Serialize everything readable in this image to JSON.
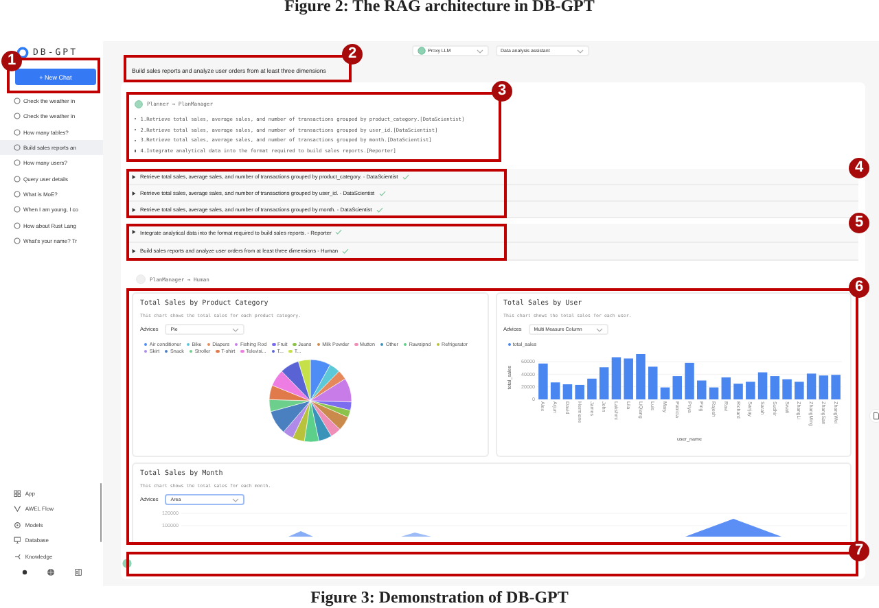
{
  "captions": {
    "top": "Figure 2: The RAG architecture in DB-GPT",
    "bottom": "Figure 3: Demonstration of DB-GPT"
  },
  "sidebar": {
    "logo": "DB-GPT",
    "new_chat": "+ New Chat",
    "chats": [
      {
        "title": "Check the weather in",
        "selected": false
      },
      {
        "title": "Check the weather in",
        "selected": false
      },
      {
        "title": "How many tables?",
        "selected": false
      },
      {
        "title": "Build sales reports an",
        "selected": true
      },
      {
        "title": "How many users?",
        "selected": false
      },
      {
        "title": "Query user details",
        "selected": false
      },
      {
        "title": "What is MoE?",
        "selected": false
      },
      {
        "title": "When I am young, I co",
        "selected": false
      },
      {
        "title": "How about Rust Lang",
        "selected": false
      },
      {
        "title": "What's your name? Tr",
        "selected": false
      }
    ],
    "menu": [
      {
        "label": "App"
      },
      {
        "label": "AWEL Flow"
      },
      {
        "label": "Models"
      },
      {
        "label": "Database"
      },
      {
        "label": "Knowledge"
      }
    ]
  },
  "toolbar": {
    "model": "Proxy LLM",
    "app": "Data analysis assistant"
  },
  "annotations": [
    "1",
    "2",
    "3",
    "4",
    "5",
    "6",
    "7"
  ],
  "message": "Build sales reports and analyze user orders from at least three dimensions",
  "planner": {
    "header": "Planner → PlanManager",
    "steps": [
      "1.Retrieve total sales, average sales, and number of transactions grouped by product_category.[DataScientist]",
      "2.Retrieve total sales, average sales, and number of transactions grouped by user_id.[DataScientist]",
      "3.Retrieve total sales, average sales, and number of transactions grouped by month.[DataScientist]",
      "4.Integrate analytical data into the format required to build sales reports.[Reporter]"
    ]
  },
  "task_groups": [
    [
      {
        "text": "Retrieve total sales, average sales, and number of transactions grouped by product_category. - DataScientist",
        "done": true
      },
      {
        "text": "Retrieve total sales, average sales, and number of transactions grouped by user_id. - DataScientist",
        "done": true
      },
      {
        "text": "Retrieve total sales, average sales, and number of transactions grouped by month. - DataScientist",
        "done": true
      }
    ],
    [
      {
        "text": "Integrate analytical data into the format required to build sales reports. - Reporter",
        "done": true
      },
      {
        "text": "Build sales reports and analyze user orders from at least three dimensions - Human",
        "done": true
      }
    ]
  ],
  "reply_header": "PlanManager → Human",
  "charts": {
    "category": {
      "title": "Total Sales by Product Category",
      "description": "This chart shows the total sales for each product category.",
      "advices_label": "Advices",
      "advice": "Pie",
      "legend": [
        {
          "label": "Air conditioner",
          "color": "#4e8df5"
        },
        {
          "label": "Bike",
          "color": "#5cc8d8"
        },
        {
          "label": "Diapers",
          "color": "#e5895c"
        },
        {
          "label": "Fishing Rod",
          "color": "#c77ce8"
        },
        {
          "label": "Fruit",
          "color": "#7b6cf0"
        },
        {
          "label": "Jeans",
          "color": "#8bc34a"
        },
        {
          "label": "Milk Powder",
          "color": "#c98a4b"
        },
        {
          "label": "Mutton",
          "color": "#ef8fb8"
        },
        {
          "label": "Other",
          "color": "#3a93b8"
        },
        {
          "label": "Rawsipnd",
          "color": "#5ccf8a"
        },
        {
          "label": "Refrigerator",
          "color": "#b8c23a"
        },
        {
          "label": "Skirt",
          "color": "#b08ae8"
        },
        {
          "label": "Snack",
          "color": "#4a7fc0"
        },
        {
          "label": "Stroller",
          "color": "#6cd08c"
        },
        {
          "label": "T-shirt",
          "color": "#e07a4a"
        },
        {
          "label": "Televisi...",
          "color": "#ee7de3"
        },
        {
          "label": "T...",
          "color": "#5a63d4"
        },
        {
          "label": "T...",
          "color": "#c6e04a"
        }
      ]
    },
    "user": {
      "title": "Total Sales by User",
      "description": "This chart shows the total sales for each user.",
      "advices_label": "Advices",
      "advice": "Multi Measure Column",
      "chart_data": {
        "type": "bar",
        "xlabel": "user_name",
        "ylabel": "total_sales",
        "categories": [
          "Alex",
          "Arjun",
          "David",
          "Hermione",
          "James",
          "John",
          "Lakshmi",
          "Lila",
          "LiQiang",
          "Luis",
          "Mary",
          "Patricia",
          "Priya",
          "Ping",
          "Rajesh",
          "Ravi",
          "Richard",
          "Sanjay",
          "Sarah",
          "Sudhir",
          "Swati",
          "ZhangLi",
          "ZhangMing",
          "ZhangSan",
          "ZhangWei"
        ],
        "series": [
          {
            "name": "total_sales",
            "color": "#4a86f0",
            "values": [
              57000,
              27000,
              24000,
              23000,
              33000,
              51000,
              67000,
              65000,
              72000,
              52000,
              19000,
              37000,
              58000,
              30000,
              19000,
              35000,
              25000,
              28000,
              43000,
              37000,
              32000,
              28000,
              41000,
              38000,
              39000
            ]
          }
        ],
        "ylim": [
          0,
          72000
        ],
        "yticks": [
          0,
          20000,
          40000,
          60000
        ],
        "grid": true
      }
    },
    "month": {
      "title": "Total Sales by Month",
      "description": "This chart shows the total sales for each month.",
      "advices_label": "Advices",
      "advice": "Area",
      "axis_ticks": [
        "120000",
        "100000"
      ]
    }
  }
}
